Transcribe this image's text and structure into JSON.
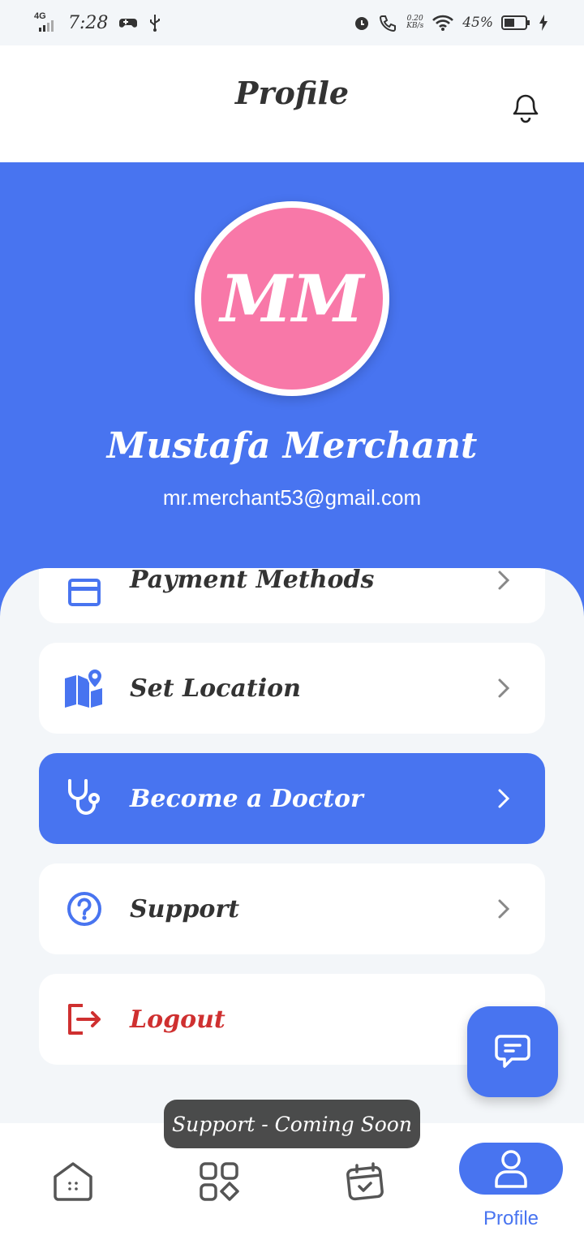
{
  "status_bar": {
    "network": "4G",
    "time": "7:28",
    "speed_value": "0.20",
    "speed_unit": "KB/s",
    "battery_percent": "45%"
  },
  "header": {
    "title": "Profile",
    "icon": "bell-icon"
  },
  "profile": {
    "initials": "MM",
    "name": "Mustafa Merchant",
    "email": "mr.merchant53@gmail.com",
    "avatar_color": "#f878a8"
  },
  "menu": {
    "items": [
      {
        "label": "Payment Methods",
        "icon": "credit-card-icon"
      },
      {
        "label": "Set Location",
        "icon": "map-pin-icon"
      },
      {
        "label": "Become a Doctor",
        "icon": "stethoscope-icon"
      },
      {
        "label": "Support",
        "icon": "question-circle-icon"
      },
      {
        "label": "Logout",
        "icon": "logout-icon"
      }
    ]
  },
  "bottom_nav": {
    "items": [
      {
        "icon": "home-icon"
      },
      {
        "icon": "categories-icon"
      },
      {
        "icon": "calendar-icon"
      },
      {
        "label": "Profile",
        "icon": "user-icon",
        "active": true
      }
    ]
  },
  "toast": {
    "text": "Support - Coming Soon"
  },
  "colors": {
    "accent": "#4874f0",
    "danger": "#cf3030",
    "background": "#f3f6f9"
  }
}
